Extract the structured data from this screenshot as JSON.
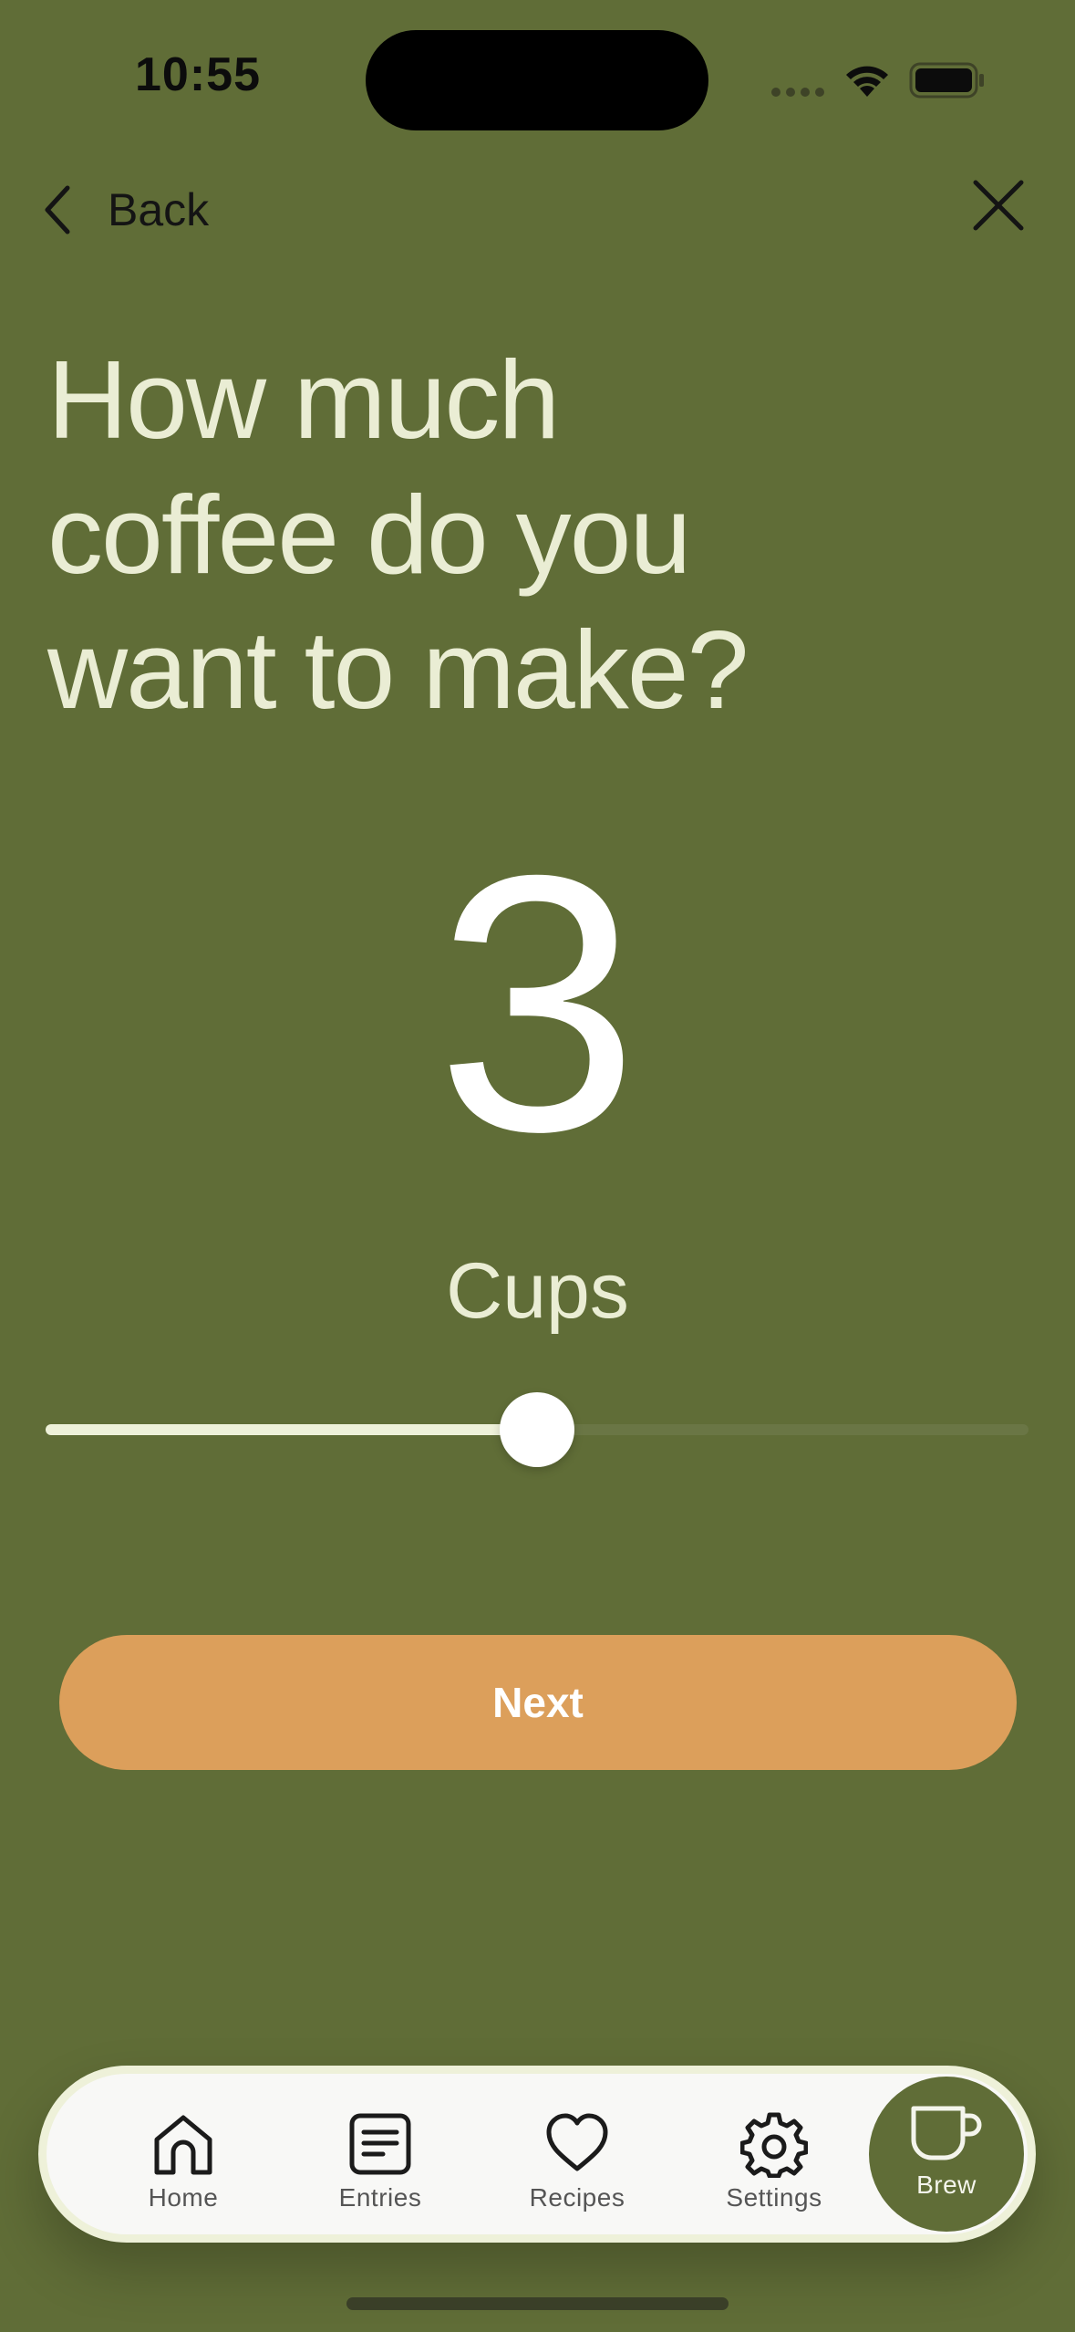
{
  "status_bar": {
    "time": "10:55",
    "icons": [
      "signal-icon",
      "wifi-icon",
      "battery-icon"
    ]
  },
  "nav": {
    "back_label": "Back",
    "back_icon": "chevron-left-icon",
    "close_icon": "close-icon"
  },
  "question": {
    "line1": "How much",
    "line2": "coffee do you",
    "line3": "want to make?"
  },
  "cups": {
    "value": "3",
    "unit": "Cups",
    "slider_fraction": 0.5
  },
  "actions": {
    "next_label": "Next"
  },
  "tab_bar": {
    "tabs": [
      {
        "label": "Home",
        "icon": "home-icon"
      },
      {
        "label": "Entries",
        "icon": "entries-icon"
      },
      {
        "label": "Recipes",
        "icon": "heart-icon"
      },
      {
        "label": "Settings",
        "icon": "gear-icon"
      },
      {
        "label": "Brew",
        "icon": "cup-icon",
        "active": true
      }
    ]
  },
  "colors": {
    "background": "#606d37",
    "accent": "#dc9f5b",
    "text_light": "#eaedd4",
    "tab_bar": "#f8f8f6"
  }
}
